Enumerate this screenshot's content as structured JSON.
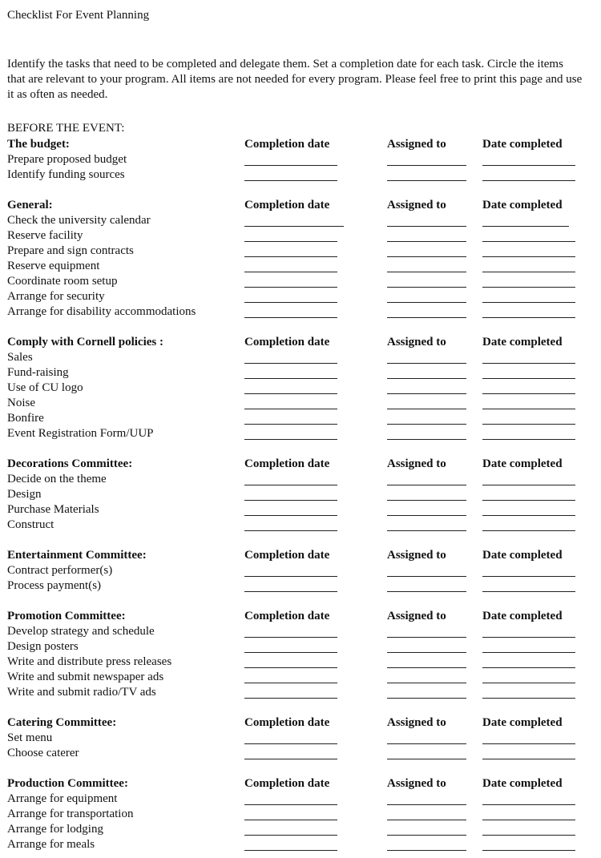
{
  "document": {
    "title": "Checklist For Event Planning",
    "intro": "Identify the tasks that need to be completed and delegate them. Set a completion date for each task. Circle the items that are relevant to your program. All items are not needed for every program. Please feel free to print this page and use it as often as needed.",
    "phase_label": "BEFORE THE EVENT:",
    "columns": {
      "completion_date": "Completion date",
      "assigned_to": "Assigned to",
      "date_completed": "Date completed"
    },
    "sections": [
      {
        "heading": "The budget:",
        "items": [
          "Prepare proposed budget",
          "Identify funding sources"
        ]
      },
      {
        "heading": "General:",
        "items": [
          "Check the university calendar",
          "Reserve facility",
          "Prepare and sign contracts",
          "Reserve equipment",
          "Coordinate room setup",
          "Arrange for security",
          "Arrange for disability accommodations"
        ]
      },
      {
        "heading": "Comply with Cornell policies :",
        "items": [
          "Sales",
          "Fund-raising",
          "Use of CU logo",
          "Noise",
          "Bonfire",
          "Event Registration Form/UUP"
        ]
      },
      {
        "heading": "Decorations Committee:",
        "items": [
          "Decide on the theme",
          "Design",
          "Purchase Materials",
          "Construct"
        ]
      },
      {
        "heading": "Entertainment Committee:",
        "items": [
          "Contract performer(s)",
          "Process payment(s)"
        ]
      },
      {
        "heading": "Promotion Committee:",
        "items": [
          "Develop strategy and schedule",
          "Design posters",
          "Write and distribute press releases",
          "Write and submit newspaper ads",
          "Write and submit radio/TV ads"
        ]
      },
      {
        "heading": "Catering Committee:",
        "items": [
          "Set menu",
          "Choose caterer"
        ]
      },
      {
        "heading": "Production Committee:",
        "items": [
          "Arrange for equipment",
          "Arrange for transportation",
          "Arrange for lodging",
          "Arrange for meals"
        ]
      }
    ]
  }
}
